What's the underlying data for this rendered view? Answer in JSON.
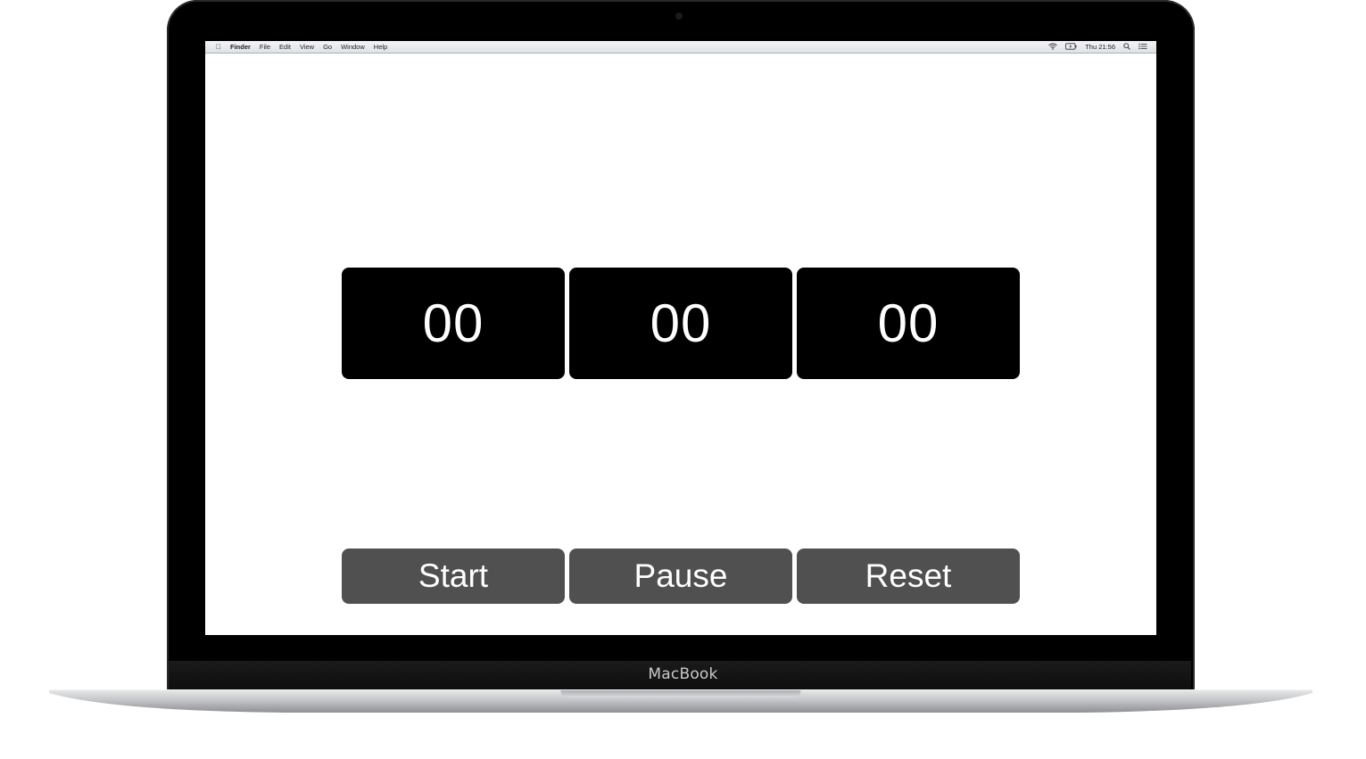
{
  "device": {
    "brand_label": "MacBook"
  },
  "menubar": {
    "apple_icon": "apple-icon",
    "app_name": "Finder",
    "items": [
      "File",
      "Edit",
      "View",
      "Go",
      "Window",
      "Help"
    ],
    "clock": "Thu 21:56",
    "status_icons": [
      "wifi-icon",
      "battery-icon",
      "search-icon",
      "list-icon"
    ]
  },
  "timer": {
    "hours": "00",
    "minutes": "00",
    "seconds": "00"
  },
  "controls": {
    "start_label": "Start",
    "pause_label": "Pause",
    "reset_label": "Reset"
  },
  "colors": {
    "timer_box": "#000000",
    "timer_text": "#ffffff",
    "button_bg": "#505050",
    "button_text": "#ffffff"
  }
}
